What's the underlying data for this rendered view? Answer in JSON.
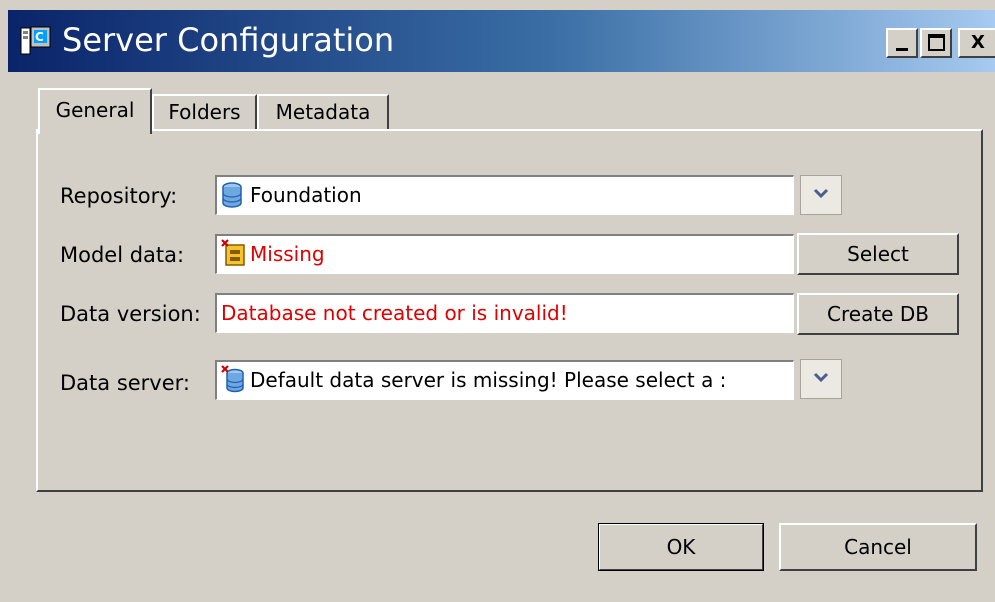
{
  "window": {
    "title": "Server Configuration",
    "controls": {
      "minimize": "_",
      "maximize": "□",
      "close": "X"
    }
  },
  "tabs": [
    {
      "label": "General",
      "active": true
    },
    {
      "label": "Folders",
      "active": false
    },
    {
      "label": "Metadata",
      "active": false
    }
  ],
  "form": {
    "repository": {
      "label": "Repository:",
      "value": "Foundation",
      "icon": "database-icon"
    },
    "model_data": {
      "label": "Model data:",
      "value": "Missing",
      "icon": "package-error-icon",
      "button": "Select"
    },
    "data_version": {
      "label": "Data version:",
      "value": "Database not created or is invalid!",
      "button": "Create DB"
    },
    "data_server": {
      "label": "Data server:",
      "value": "Default data server is missing! Please select a :",
      "icon": "server-error-icon"
    }
  },
  "buttons": {
    "ok": "OK",
    "cancel": "Cancel"
  },
  "colors": {
    "title_gradient_start": "#0a246a",
    "title_gradient_end": "#a6caf0",
    "window_bg": "#d4d0c8",
    "error_text": "#e00000"
  }
}
